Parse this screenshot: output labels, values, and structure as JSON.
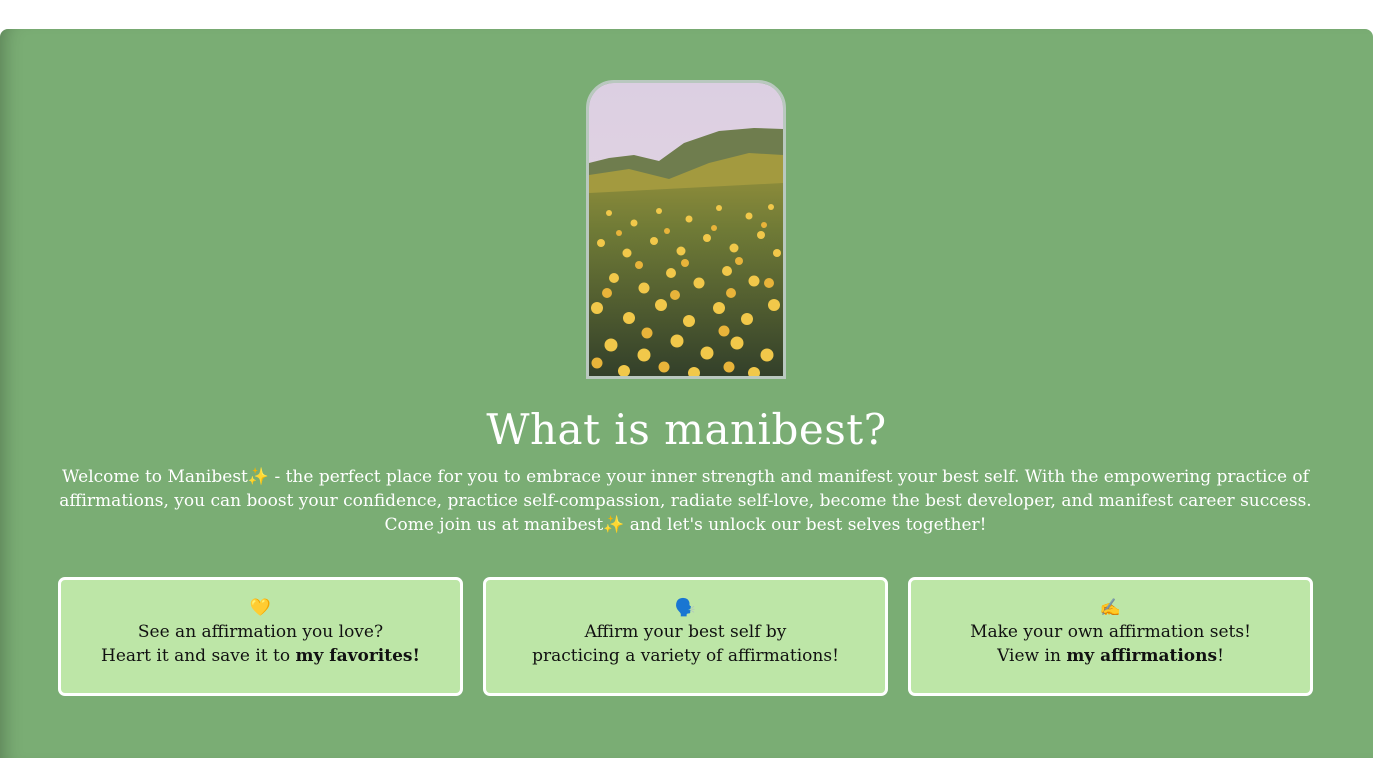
{
  "hero": {
    "title": "What is manibest?"
  },
  "intro": {
    "part1": "Welcome to Manibest",
    "sparkle": "✨",
    "part2": " - the perfect place for you to embrace your inner strength and manifest your best self. With the empowering practice of affirmations, you can boost your confidence, practice self-compassion, radiate self-love, become the best developer, and manifest career success. Come join us at manibest",
    "part3": " and let's unlock our best selves together!"
  },
  "cards": [
    {
      "emoji": "💛",
      "line1": "See an affirmation you love?",
      "line2_prefix": "Heart it and save it to ",
      "line2_bold": "my favorites!",
      "line2_suffix": ""
    },
    {
      "emoji": "🗣️",
      "line1": "Affirm your best self by",
      "line2_prefix": "practicing a variety of affirmations!",
      "line2_bold": "",
      "line2_suffix": ""
    },
    {
      "emoji": "✍️",
      "line1": "Make your own affirmation sets!",
      "line2_prefix": "View in ",
      "line2_bold": "my affirmations",
      "line2_suffix": "!"
    }
  ],
  "colors": {
    "panel": "#7aad74",
    "card": "#bde6a7",
    "text_light": "#ffffff"
  }
}
